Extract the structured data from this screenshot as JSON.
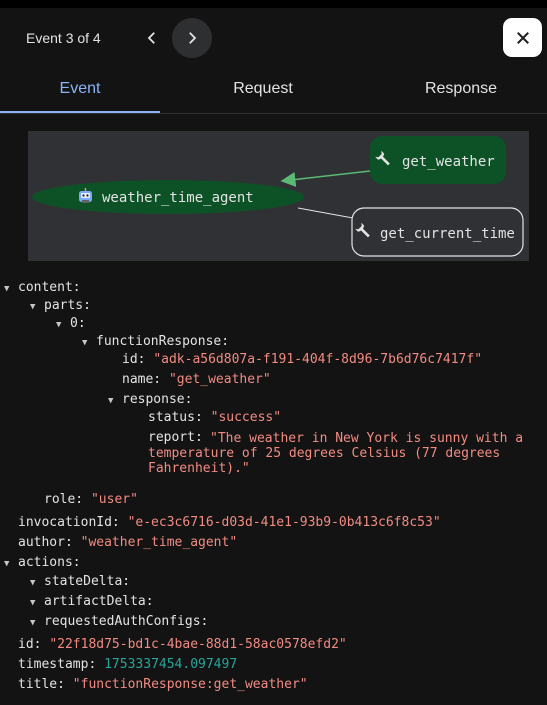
{
  "header": {
    "event_counter": "Event 3 of 4"
  },
  "tabs": [
    {
      "label": "Event"
    },
    {
      "label": "Request"
    },
    {
      "label": "Response"
    }
  ],
  "graph": {
    "nodes": {
      "agent": {
        "label": "weather_time_agent",
        "icon": "robot-icon"
      },
      "tool_active": {
        "label": "get_weather",
        "icon": "wrench-icon"
      },
      "tool_other": {
        "label": "get_current_time",
        "icon": "wrench-icon"
      }
    }
  },
  "event": {
    "content_key": "content:",
    "parts_key": "parts:",
    "index_key": "0:",
    "function_response_key": "functionResponse:",
    "id_key": "id:",
    "id_value": "\"adk-a56d807a-f191-404f-8d96-7b6d76c7417f\"",
    "name_key": "name:",
    "name_value": "\"get_weather\"",
    "response_key": "response:",
    "status_key": "status:",
    "status_value": "\"success\"",
    "report_key": "report:",
    "report_value": "\"The weather in New York is sunny with a temperature of 25 degrees Celsius (77 degrees Fahrenheit).\"",
    "role_key": "role:",
    "role_value": "\"user\"",
    "invocation_key": "invocationId:",
    "invocation_value": "\"e-ec3c6716-d03d-41e1-93b9-0b413c6f8c53\"",
    "author_key": "author:",
    "author_value": "\"weather_time_agent\"",
    "actions_key": "actions:",
    "state_delta_key": "stateDelta:",
    "artifact_delta_key": "artifactDelta:",
    "requested_auth_key": "requestedAuthConfigs:",
    "event_id_key": "id:",
    "event_id_value": "\"22f18d75-bd1c-4bae-88d1-58ac0578efd2\"",
    "timestamp_key": "timestamp:",
    "timestamp_value": "1753337454.097497",
    "title_key": "title:",
    "title_value": "\"functionResponse:get_weather\""
  },
  "colors": {
    "accent": "#8ab4f8",
    "string": "#f28b82",
    "number": "#26a69a",
    "node_green": "#0d5226",
    "edge_green": "#5bb974"
  }
}
